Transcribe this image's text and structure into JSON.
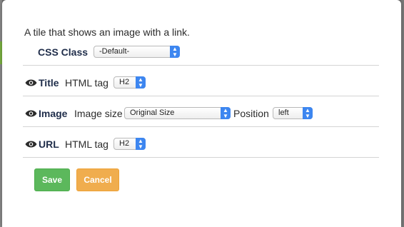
{
  "description": "A tile that shows an image with a link.",
  "css_class": {
    "label": "CSS Class",
    "value": "-Default-"
  },
  "title_row": {
    "label": "Title",
    "tag_label": "HTML tag",
    "tag_value": "H2",
    "icon": "eye-icon"
  },
  "image_row": {
    "label": "Image",
    "size_label": "Image size",
    "size_value": "Original Size",
    "position_label": "Position",
    "position_value": "left",
    "icon": "eye-icon"
  },
  "url_row": {
    "label": "URL",
    "tag_label": "HTML tag",
    "tag_value": "H2",
    "icon": "eye-icon"
  },
  "buttons": {
    "save": "Save",
    "cancel": "Cancel"
  },
  "colors": {
    "save": "#5cb85c",
    "cancel": "#f0ad4e",
    "select_arrow": "#3d86f0",
    "label_text": "#1f2d4a"
  }
}
